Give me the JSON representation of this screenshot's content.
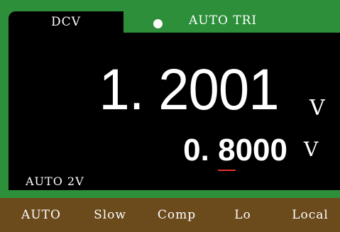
{
  "header": {
    "mode": "DCV",
    "status": "AUTO TRI"
  },
  "readout": {
    "primary_value": "1. 2001",
    "primary_unit": "V",
    "secondary_value_prefix": "0. ",
    "secondary_value_cursor_digit": "8",
    "secondary_value_suffix": "000",
    "secondary_unit": "V",
    "range": "AUTO 2V"
  },
  "softkeys": [
    "AUTO",
    "Slow",
    "Comp",
    "Lo",
    "Local"
  ],
  "colors": {
    "frame_green": "#2d8f3a",
    "screen_black": "#000000",
    "softkey_brown": "#6b4a1c",
    "cursor_red": "#e53030",
    "text_white": "#ffffff"
  },
  "icons": {
    "status_indicator": "filled-circle"
  }
}
